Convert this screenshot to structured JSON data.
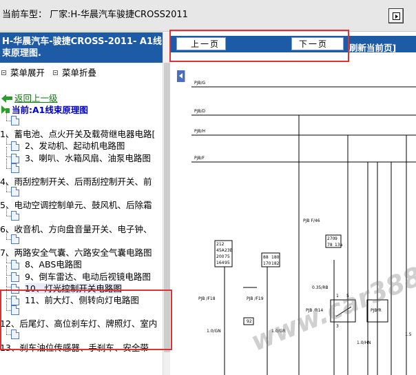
{
  "topbar": {
    "title": "当前车型：  厂家:H-华晨汽车骏捷CROSS2011"
  },
  "left": {
    "header": "H-华晨汽车-骏捷CROSS-2011- A1线束原理图.",
    "expand_label": "菜单展开",
    "collapse_label": "菜单折叠",
    "back_label": "返回上一级",
    "current_label": "当前:A1线束原理图",
    "tree": [
      {
        "label": "",
        "level": 1,
        "kind": "doc"
      },
      {
        "label": "1、蓄电池、点火开关及载荷继电器电路[",
        "level": 0,
        "kind": "folder"
      },
      {
        "label": "2、发动机、起动机电路图",
        "level": 1,
        "kind": "doc"
      },
      {
        "label": "3、喇叭、水箱风扇、油泵电路图",
        "level": 1,
        "kind": "doc"
      },
      {
        "label": "",
        "level": 1,
        "kind": "doc"
      },
      {
        "label": "4、雨刮控制开关、后雨刮控制开关、前",
        "level": 0,
        "kind": "folder"
      },
      {
        "label": "",
        "level": 1,
        "kind": "doc"
      },
      {
        "label": "5、电动空调控制单元、鼓风机、后除霜",
        "level": 0,
        "kind": "folder"
      },
      {
        "label": "",
        "level": 1,
        "kind": "doc"
      },
      {
        "label": "6、收音机、方向盘音量开关、电子钟、",
        "level": 0,
        "kind": "folder"
      },
      {
        "label": "",
        "level": 1,
        "kind": "doc"
      },
      {
        "label": "7、两路安全气囊、六路安全气囊电路图",
        "level": 0,
        "kind": "folder"
      },
      {
        "label": "8、ABS电路图",
        "level": 1,
        "kind": "doc"
      },
      {
        "label": "9、倒车雷达、电动后视镜电路图",
        "level": 1,
        "kind": "doc"
      },
      {
        "label": "10、灯光控制开关电路图",
        "level": 1,
        "kind": "doc",
        "selected": true
      },
      {
        "label": "11、前大灯、侧转向灯电路图",
        "level": 1,
        "kind": "doc"
      },
      {
        "label": "",
        "level": 1,
        "kind": "doc"
      },
      {
        "label": "12、后尾灯、高位刹车灯、牌照灯、室内",
        "level": 0,
        "kind": "folder"
      },
      {
        "label": "",
        "level": 1,
        "kind": "doc"
      },
      {
        "label": "13、刹车油位传感器、手刹车、安全带",
        "level": 0,
        "kind": "folder"
      }
    ]
  },
  "right": {
    "prev_label": "上一页",
    "next_label": "下一页",
    "refresh_label": "刷新当前页]",
    "diagram_labels": {
      "pjb_g": "PJB/G",
      "pjb_d": "PJB/D",
      "pjb_h": "PJB/H",
      "pjb_f": "PJB/F",
      "pjb_f46": "PJB F/46",
      "pjb_f18": "PJB /F18",
      "pjb_f19": "PJB /F19",
      "pjb_r14": "PJB /R14",
      "pjb_r": "PJB/R",
      "wire_035rb": "0.35/RB",
      "wire_10gn": "1.0/GN",
      "wire_10gr": "1.0/GR",
      "wire_10hn": "1.0/HN",
      "wire_15": "1.5",
      "fuse_table_a": [
        [
          "212",
          ""
        ],
        [
          "45A",
          "23B"
        ],
        [
          "200",
          "75"
        ],
        [
          "164",
          "95"
        ]
      ],
      "fuse_table_b": [
        [
          "88",
          "180"
        ],
        [
          "170",
          "182"
        ]
      ],
      "fuse_table_c": [
        [
          "270",
          "9"
        ],
        [
          "78",
          "13a"
        ]
      ],
      "box_92": "92",
      "num_1": "1",
      "num_5": "5",
      "num_3": "3"
    },
    "watermark": "www.car388.com"
  }
}
